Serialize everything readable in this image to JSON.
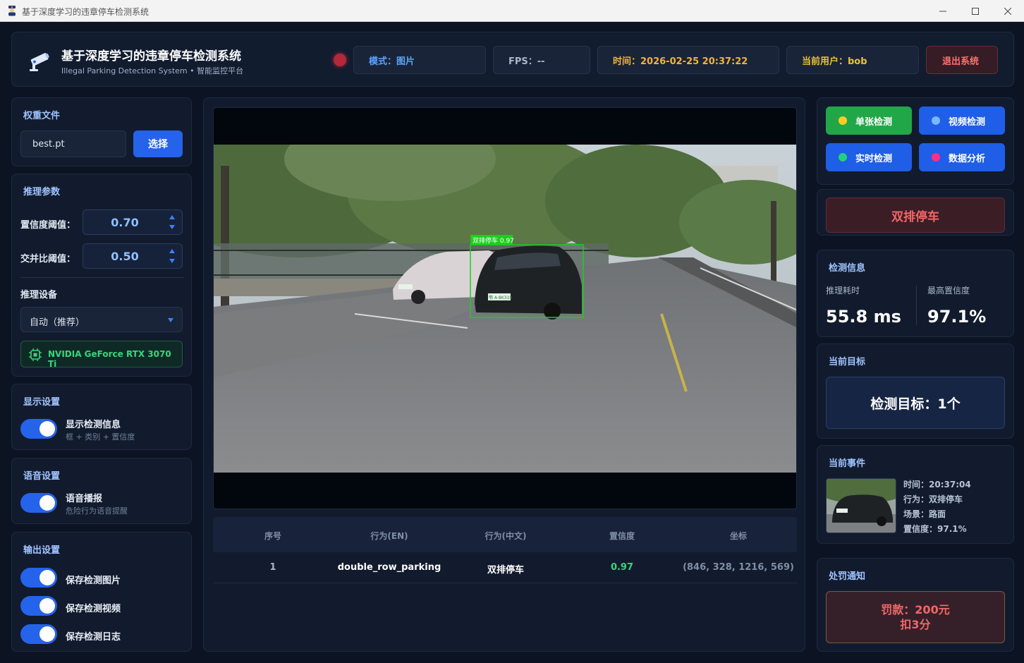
{
  "window": {
    "title": "基于深度学习的违章停车检测系统"
  },
  "header": {
    "title": "基于深度学习的违章停车检测系统",
    "subtitle": "Illegal Parking Detection System • 智能监控平台",
    "mode": "模式：图片",
    "fps": "FPS：--",
    "time": "时间：2026-02-25 20:37:22",
    "user": "当前用户：bob",
    "logout": "退出系统",
    "status_color": "#b3283a"
  },
  "weights": {
    "title": "权重文件",
    "file": "best.pt",
    "choose": "选择"
  },
  "inference": {
    "title": "推理参数",
    "conf_label": "置信度阈值：",
    "conf_value": "0.70",
    "iou_label": "交并比阈值：",
    "iou_value": "0.50",
    "device_label": "推理设备",
    "device_value": "自动（推荐）",
    "gpu": "NVIDIA GeForce RTX 3070 Ti"
  },
  "display": {
    "title": "显示设置",
    "toggle_label": "显示检测信息",
    "toggle_sub": "框 + 类别 + 置信度",
    "on": true
  },
  "voice": {
    "title": "语音设置",
    "toggle_label": "语音播报",
    "toggle_sub": "危险行为语音提醒",
    "on": true
  },
  "output": {
    "title": "输出设置",
    "items": [
      {
        "label": "保存检测图片",
        "on": true
      },
      {
        "label": "保存检测视频",
        "on": true
      },
      {
        "label": "保存检测日志",
        "on": true
      }
    ]
  },
  "detection_overlay": {
    "label": "双排停车 0.97",
    "plate": "鄂 A·8K319"
  },
  "table": {
    "headers": [
      "序号",
      "行为(EN)",
      "行为(中文)",
      "置信度",
      "坐标"
    ],
    "rows": [
      [
        "1",
        "double_row_parking",
        "双排停车",
        "0.97",
        "(846, 328, 1216, 569)"
      ]
    ]
  },
  "nav": {
    "single": "单张检测",
    "video": "视频检测",
    "realtime": "实时检测",
    "analysis": "数据分析"
  },
  "alert": {
    "behavior": "双排停车"
  },
  "stats": {
    "title": "检测信息",
    "latency_label": "推理耗时",
    "latency_value": "55.8 ms",
    "max_conf_label": "最高置信度",
    "max_conf_value": "97.1%"
  },
  "target": {
    "title": "当前目标",
    "text": "检测目标：1个"
  },
  "event": {
    "title": "当前事件",
    "time": "时间：20:37:04",
    "behavior": "行为：双排停车",
    "scene": "场景：路面",
    "confidence": "置信度：97.1%"
  },
  "penalty": {
    "title": "处罚通知",
    "fine": "罚款：200元",
    "points": "扣3分"
  }
}
